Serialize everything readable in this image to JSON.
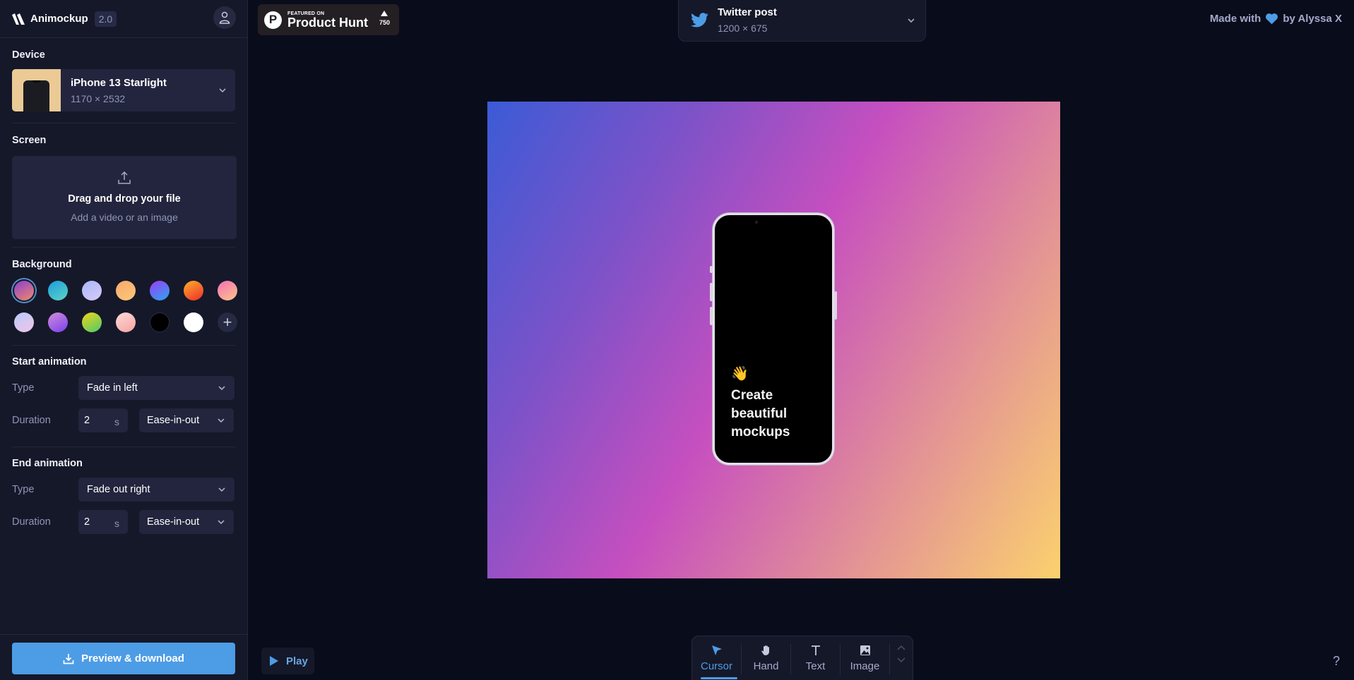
{
  "app": {
    "name": "Animockup",
    "version": "2.0"
  },
  "sidebar": {
    "device": {
      "title": "Device",
      "name": "iPhone 13 Starlight",
      "resolution": "1170 × 2532"
    },
    "screen": {
      "title": "Screen",
      "drop_title": "Drag and drop your file",
      "drop_subtitle": "Add a video or an image",
      "icon": "upload-icon"
    },
    "background": {
      "title": "Background",
      "selected_index": 0,
      "swatches": [
        {
          "name": "purple-pink-orange",
          "colors": [
            "#8a3fd1",
            "#f08a6a"
          ]
        },
        {
          "name": "blue-teal",
          "colors": [
            "#1d9be0",
            "#5ed4c2"
          ]
        },
        {
          "name": "lavender",
          "colors": [
            "#a8b8f8",
            "#d8c9fb"
          ]
        },
        {
          "name": "peach",
          "colors": [
            "#f8a86a",
            "#fbc97a"
          ]
        },
        {
          "name": "violet-blue",
          "colors": [
            "#9b3df5",
            "#2aa7f0"
          ]
        },
        {
          "name": "orange-red",
          "colors": [
            "#fbb02c",
            "#ee2b2b"
          ]
        },
        {
          "name": "pink-peach",
          "colors": [
            "#f56fb5",
            "#fbc68a"
          ]
        },
        {
          "name": "lilac",
          "colors": [
            "#b8cbfb",
            "#f1c4e8"
          ]
        },
        {
          "name": "mauve-violet",
          "colors": [
            "#d08ed8",
            "#7b3ff0"
          ]
        },
        {
          "name": "yellow-green",
          "colors": [
            "#f3d31a",
            "#49cc6b"
          ]
        },
        {
          "name": "blush",
          "colors": [
            "#fbdada",
            "#f6a3a0"
          ]
        },
        {
          "name": "black",
          "colors": [
            "#000000",
            "#000000"
          ]
        },
        {
          "name": "white",
          "colors": [
            "#ffffff",
            "#ffffff"
          ]
        }
      ],
      "add_label": "+"
    },
    "start_animation": {
      "title": "Start animation",
      "type_label": "Type",
      "type_value": "Fade in left",
      "duration_label": "Duration",
      "duration_value": "2",
      "duration_unit": "s",
      "easing": "Ease-in-out"
    },
    "end_animation": {
      "title": "End animation",
      "type_label": "Type",
      "type_value": "Fade out right",
      "duration_label": "Duration",
      "duration_value": "2",
      "duration_unit": "s",
      "easing": "Ease-in-out"
    },
    "download_label": "Preview & download"
  },
  "product_hunt": {
    "featured": "FEATURED ON",
    "name": "Product Hunt",
    "votes": "750"
  },
  "format": {
    "name": "Twitter post",
    "size": "1200 × 675"
  },
  "credit": {
    "prefix": "Made with",
    "suffix": "by Alyssa X"
  },
  "canvas": {
    "gradient": [
      "#3b5bd6",
      "#c64fbf",
      "#fbd16e"
    ],
    "emoji": "👋",
    "headline": "Create beautiful mockups"
  },
  "playback": {
    "play_label": "Play"
  },
  "toolbar": {
    "tools": [
      {
        "label": "Cursor",
        "active": true
      },
      {
        "label": "Hand",
        "active": false
      },
      {
        "label": "Text",
        "active": false
      },
      {
        "label": "Image",
        "active": false
      }
    ]
  },
  "help_label": "?",
  "colors": {
    "accent": "#4d9ce6",
    "sidebar_bg": "#151829",
    "page_bg": "#090c1b"
  }
}
